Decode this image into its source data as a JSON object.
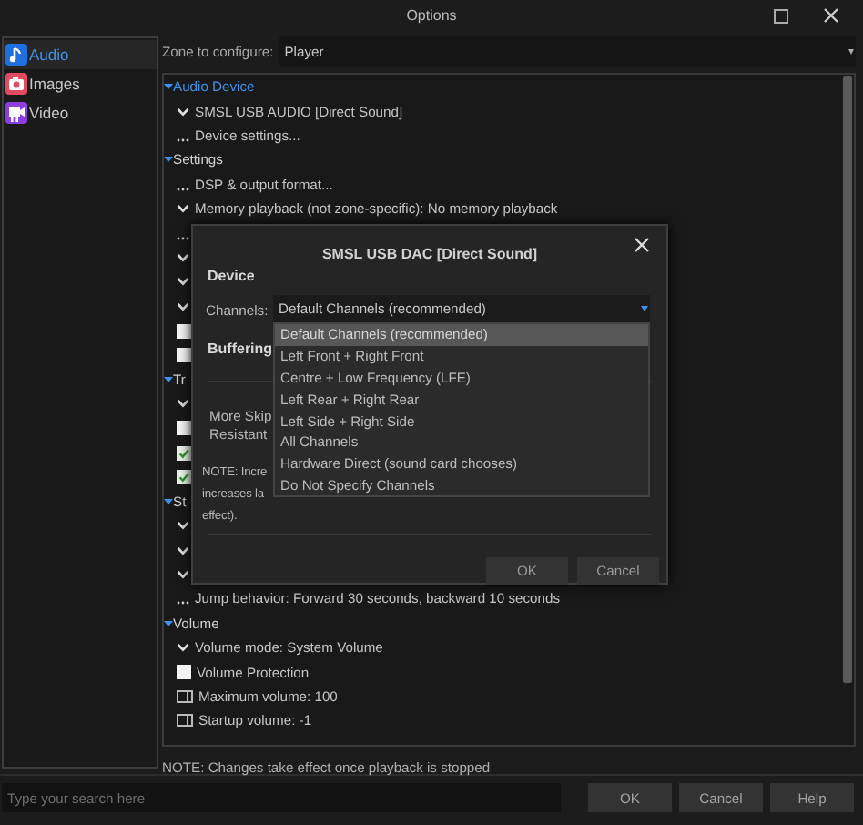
{
  "window": {
    "title": "Options"
  },
  "sidebar": {
    "items": [
      {
        "label": "Audio",
        "selected": true
      },
      {
        "label": "Images",
        "selected": false
      },
      {
        "label": "Video",
        "selected": false
      }
    ]
  },
  "zone": {
    "label": "Zone to configure:",
    "value": "Player"
  },
  "tree": [
    {
      "label": "Audio Device",
      "selected": true,
      "expanded": true,
      "children": [
        {
          "kind": "dropdown",
          "label": "SMSL USB AUDIO [Direct Sound]"
        },
        {
          "kind": "action",
          "label": "Device settings..."
        }
      ]
    },
    {
      "label": "Settings",
      "selected": false,
      "expanded": true,
      "children": [
        {
          "kind": "action",
          "label": "DSP & output format..."
        },
        {
          "kind": "dropdown",
          "label": "Memory playback (not zone-specific): No memory playback"
        },
        {
          "kind": "action"
        },
        {
          "kind": "dropdown"
        },
        {
          "kind": "dropdown"
        },
        {
          "kind": "dropdown"
        },
        {
          "kind": "checkbox",
          "checked": false
        },
        {
          "kind": "checkbox",
          "checked": false
        }
      ]
    },
    {
      "label": "Tr",
      "selected": false,
      "expanded": true,
      "children": [
        {
          "kind": "dropdown"
        },
        {
          "kind": "checkbox",
          "checked": false
        },
        {
          "kind": "checkbox",
          "checked": true
        },
        {
          "kind": "checkbox",
          "checked": true
        }
      ]
    },
    {
      "label": "St",
      "selected": false,
      "expanded": true,
      "children": [
        {
          "kind": "dropdown"
        },
        {
          "kind": "dropdown"
        },
        {
          "kind": "dropdown"
        },
        {
          "kind": "action",
          "label": "Jump behavior: Forward 30 seconds, backward 10 seconds"
        }
      ]
    },
    {
      "label": "Volume",
      "selected": false,
      "expanded": true,
      "children": [
        {
          "kind": "dropdown",
          "label": "Volume mode: System Volume"
        },
        {
          "kind": "checkbox",
          "checked": false,
          "label": "Volume Protection"
        },
        {
          "kind": "number",
          "label": "Maximum volume: 100"
        },
        {
          "kind": "number",
          "label": "Startup volume: -1"
        }
      ]
    }
  ],
  "note": "NOTE: Changes take effect once playback is stopped",
  "search": {
    "placeholder": "Type your search here"
  },
  "buttons": [
    "OK",
    "Cancel",
    "Help"
  ],
  "dialog": {
    "title": "SMSL USB DAC [Direct Sound]",
    "device_heading": "Device",
    "channels_label": "Channels:",
    "channels_value": "Default Channels (recommended)",
    "options": [
      {
        "label": "Default Channels (recommended)",
        "selected": true
      },
      {
        "label": "Left Front + Right Front",
        "selected": false
      },
      {
        "label": "Centre + Low Frequency (LFE)",
        "selected": false
      },
      {
        "label": "Left Rear + Right Rear",
        "selected": false
      },
      {
        "label": "Left Side + Right Side",
        "selected": false
      },
      {
        "label": "All Channels",
        "selected": false
      },
      {
        "label": "Hardware Direct (sound card chooses)",
        "selected": false
      },
      {
        "label": "Do Not Specify Channels",
        "selected": false
      }
    ],
    "buffering_heading": "Buffering",
    "skip_label": "More Skip Resistant",
    "note_lines": [
      "NOTE: Incre",
      "increases la",
      "effect)."
    ],
    "buttons": [
      "OK",
      "Cancel"
    ]
  }
}
